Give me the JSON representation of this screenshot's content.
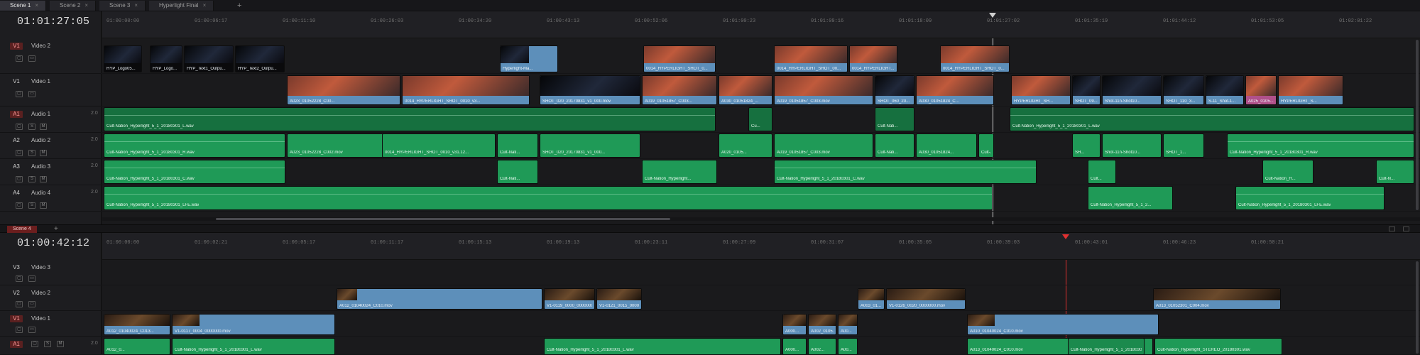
{
  "tabs": [
    {
      "label": "Scene 1",
      "active": true
    },
    {
      "label": "Scene 2",
      "active": false
    },
    {
      "label": "Scene 3",
      "active": false
    },
    {
      "label": "Hyperlight Final",
      "active": false
    }
  ],
  "tab_add_icon": "plus-icon",
  "top_timeline": {
    "timecode": "01:01:27:05",
    "ruler_ticks": [
      "01:00:00:00",
      "01:00:06:17",
      "01:00:11:10",
      "01:00:26:03",
      "01:00:34:20",
      "01:00:43:13",
      "01:00:52:06",
      "01:01:00:23",
      "01:01:09:16",
      "01:01:18:09",
      "01:01:27:02",
      "01:01:35:19",
      "01:01:44:12",
      "01:01:53:05",
      "01:02:01:22"
    ],
    "playhead_color": "#d0d0d0",
    "tracks": [
      {
        "id": "V1",
        "label": "Video 2",
        "vol": "",
        "kind": "video"
      },
      {
        "id": "V1",
        "label": "Video 1",
        "vol": "",
        "kind": "video"
      },
      {
        "id": "A1",
        "label": "Audio 1",
        "vol": "2.0",
        "kind": "audio"
      },
      {
        "id": "A2",
        "label": "Audio 2",
        "vol": "2.0",
        "kind": "audio"
      },
      {
        "id": "A3",
        "label": "Audio 3",
        "vol": "2.0",
        "kind": "audio"
      },
      {
        "id": "A4",
        "label": "Audio 4",
        "vol": "2.0",
        "kind": "audio"
      }
    ],
    "clips_video2": [
      "HYP_Logo05...",
      "HYP_Logo...",
      "HYP_Text1_Outpu...",
      "HYP_Text2_Outpu...",
      "Hyperlight-Ma...",
      "0014_HYPERLIGHT_SHOT_0...",
      "0014_HYPERLIGHT_SHOT_00...",
      "0014_HYPERLIGHT...",
      "0014_HYPERLIGHT_SHOT_0..."
    ],
    "clips_video1": [
      "A023_01052228_C00...",
      "0014_HYPERLIGHT_SHOT_0010_v3...",
      "SHOT_020_20170831_v1_000.mov",
      "A019_01051857_C003...",
      "A030_01051824_...",
      "A019_01051857_C003.mov",
      "SHOT_060_20...",
      "A030_01051824_C...",
      "HYPERLIGHT_SH...",
      "SHOT_09...",
      "Shot-11n-Shot10...",
      "SHOT_110_3...",
      "S-11_Shot-1...",
      "A025_0105...",
      "HYPERLIGHT_S..."
    ],
    "clips_audio1": [
      "Cult-Nation_Hyperlight_5_1_20180301_L.wav",
      "Cu...",
      "Cult-Nati...",
      "Cult-Nation_Hyperlight_5_1_20180301_L.wav"
    ],
    "clips_audio2": [
      "Cult-Nation_Hyperlight_5_1_20180301_R.wav",
      "A023_01052228_C002.mov",
      "0014_HYPERLIGHT_SHOT_0010_v31.12...",
      "Cult-Nati...",
      "SHOT_020_20170831_v1_000...",
      "A020_0105...",
      "A019_01051857_C003.mov",
      "Cult-Nati...",
      "A030_01051824...",
      "Cult-...",
      "SH...",
      "Shot-11n-Shot10...",
      "SHOT_1...",
      "Cult-Nation_Hyperlight_5_1_20180301_R.wav"
    ],
    "clips_audio3": [
      "Cult-Nation_Hyperlight_5_1_20180301_C.wav",
      "Cult-Nati...",
      "Cult-Nation_Hyperlight...",
      "Cult-Nation_Hyperlight_5_1_20180301_C.wav",
      "Cult...",
      "Cult-Nation_H...",
      "Cult-N..."
    ],
    "clips_audio4": [
      "Cult-Nation_Hyperlight_5_1_20180301_LFE.wav",
      "Cult-Nation_Hyperlight_5_1_2...",
      "Cult-Nation_Hyperlight_5_1_20180301_LFE.wav"
    ]
  },
  "bottom_timeline": {
    "scene_tab": "Scene 4",
    "timecode": "01:00:42:12",
    "ruler_ticks": [
      "01:00:00:00",
      "01:00:02:21",
      "01:00:05:17",
      "01:00:11:17",
      "01:00:15:13",
      "01:00:19:13",
      "01:00:23:11",
      "01:00:27:09",
      "01:00:31:07",
      "01:00:35:05",
      "01:00:39:03",
      "01:00:43:01",
      "01:00:46:23",
      "01:00:50:21"
    ],
    "playhead_color": "#e03030",
    "tracks": [
      {
        "id": "V3",
        "label": "Video 3",
        "vol": "",
        "kind": "video"
      },
      {
        "id": "V2",
        "label": "Video 2",
        "vol": "",
        "kind": "video"
      },
      {
        "id": "V1",
        "label": "Video 1",
        "vol": "",
        "kind": "video"
      },
      {
        "id": "A1",
        "label": "",
        "vol": "2.0",
        "kind": "audio"
      }
    ],
    "clips_video2": [
      "A012_01040024_C010.mov",
      "V1-0119_0000_0000000.mov",
      "V1-0121_0015_0000000.mov",
      "A003_01...",
      "V1-0126_0020_0000000.mov",
      "A013_01052301_C004.mov"
    ],
    "clips_video1": [
      "A012_01040024_C013...",
      "V1-0117_0004_0000000.mov",
      "A000...",
      "A002_0105...",
      "A00...",
      "A010_01040024_C010.mov"
    ],
    "clips_audio1": [
      "A012_0...",
      "Cult-Nation_Hyperlight_5_1_20180301_L.wav",
      "Cult-Nation_Hyperlight_5_1_20180301_L.wav",
      "A000...",
      "A002...",
      "A00...",
      "A013_01040024_C010.mov",
      "Cult-Nation_Hyperlight_5_1_20180301_L.wav",
      "Cult-Nation_Hyperlight_STEREO_20180301.wav"
    ]
  },
  "colors": {
    "video_clip": "#5d8fba",
    "audio_clip": "#1f9a57",
    "record_red": "#6b1e1e"
  }
}
